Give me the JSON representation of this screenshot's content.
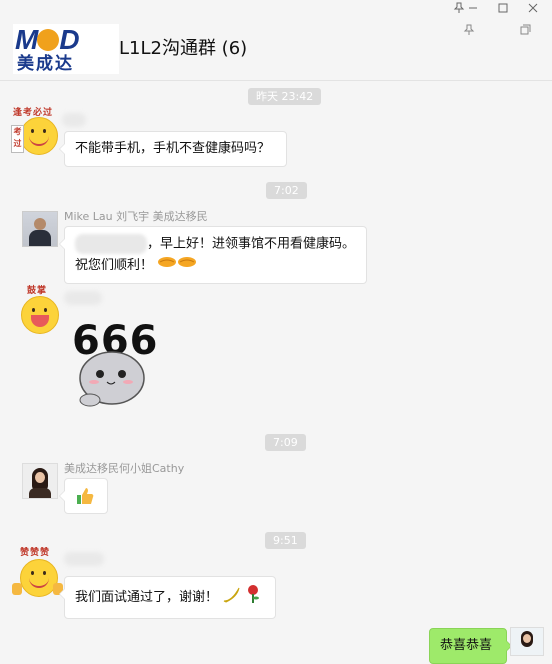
{
  "window": {
    "title": "L1L2沟通群 (6)",
    "controls": [
      "pin-icon",
      "minimize-icon",
      "maximize-icon",
      "close-icon"
    ]
  },
  "logo": {
    "brand": "M",
    "brand_rest": "D",
    "chinese": "美成达"
  },
  "stickers": {
    "sticker1_caption": "逢考必过",
    "sticker1_sign": "考过",
    "sticker2_caption": "鼓掌",
    "sticker3_caption": "赞赞赞",
    "meme_text": "666"
  },
  "messages": {
    "ts1": "昨天 23:42",
    "m1_text": "不能带手机，手机不查健康码吗？",
    "ts2": "7:02",
    "m2_sender": "Mike Lau 刘飞宇 美成达移民",
    "m2_line1": "，早上好！进领事馆不用看健康码。",
    "m2_line2": "祝您们顺利！",
    "m2_emoji": "handshake-emoji",
    "ts3": "7:09",
    "m3_sender": "美成达移民何小姐Cathy",
    "m3_emoji": "thumbs-up-emoji",
    "ts4": "9:51",
    "m4_text": "我们面试通过了，谢谢！",
    "m4_emojis": [
      "banana-emoji",
      "rose-emoji"
    ],
    "m5_text": "恭喜恭喜"
  },
  "colors": {
    "brand_blue": "#1a3a8c",
    "brand_orange": "#f0a11c",
    "self_bubble": "#9eea6a"
  }
}
